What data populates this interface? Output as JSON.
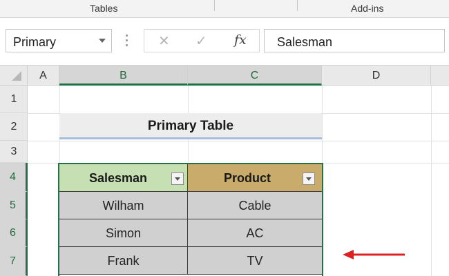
{
  "ribbon": {
    "groups": [
      "Tables",
      "Add-ins"
    ]
  },
  "formula_bar": {
    "name_box": "Primary",
    "cancel_icon": "close-icon",
    "enter_icon": "checkmark-icon",
    "fx_label": "fx",
    "formula_value": "Salesman"
  },
  "grid": {
    "columns": [
      "A",
      "B",
      "C",
      "D"
    ],
    "rows": [
      "1",
      "2",
      "3",
      "4",
      "5",
      "6",
      "7"
    ],
    "selected_columns": [
      "B",
      "C"
    ],
    "selected_rows": [
      "4",
      "5",
      "6",
      "7"
    ]
  },
  "sheet": {
    "title": "Primary Table",
    "table": {
      "headers": [
        "Salesman",
        "Product"
      ],
      "rows": [
        [
          "Wilham",
          "Cable"
        ],
        [
          "Simon",
          "AC"
        ],
        [
          "Frank",
          "TV"
        ]
      ]
    }
  },
  "colors": {
    "accent": "#217346",
    "salesman_header": "#c6e0b4",
    "product_header": "#c9ac6b",
    "cell_fill": "#d0d0d0",
    "title_underline": "#a6bde0",
    "arrow": "#e02020"
  }
}
